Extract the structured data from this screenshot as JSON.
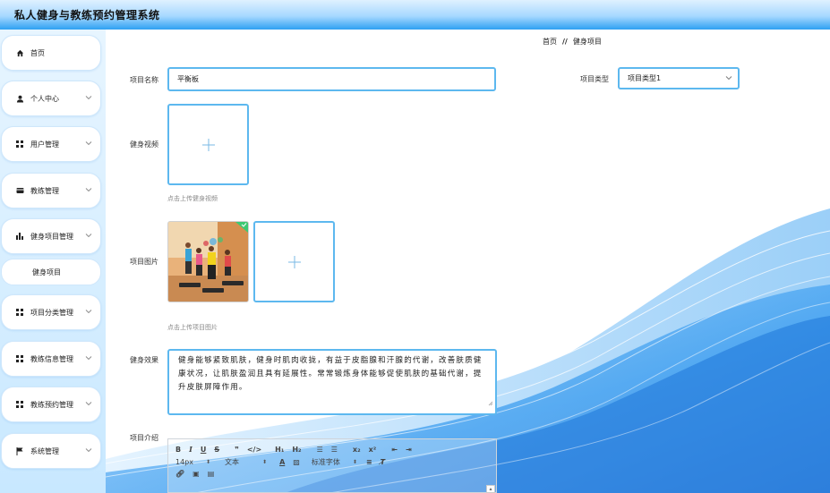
{
  "app": {
    "title": "私人健身与教练预约管理系统"
  },
  "sidebar": {
    "items": [
      {
        "label": "首页",
        "icon": "home-icon",
        "has_arrow": false
      },
      {
        "label": "个人中心",
        "icon": "user-icon",
        "has_arrow": true
      },
      {
        "label": "用户管理",
        "icon": "grid-icon",
        "has_arrow": true
      },
      {
        "label": "教练管理",
        "icon": "card-icon",
        "has_arrow": true
      },
      {
        "label": "健身项目管理",
        "icon": "bar-chart-icon",
        "has_arrow": true,
        "expanded": true
      },
      {
        "label": "项目分类管理",
        "icon": "grid-icon",
        "has_arrow": true
      },
      {
        "label": "教练信息管理",
        "icon": "grid-icon",
        "has_arrow": true
      },
      {
        "label": "教练预约管理",
        "icon": "grid-icon",
        "has_arrow": true
      },
      {
        "label": "系统管理",
        "icon": "flag-icon",
        "has_arrow": true
      }
    ],
    "subitem": {
      "label": "健身项目"
    }
  },
  "breadcrumb": {
    "home": "首页",
    "separator": "//",
    "current": "健身项目"
  },
  "form": {
    "name_label": "项目名称",
    "name_value": "平衡板",
    "type_label": "项目类型",
    "type_value": "项目类型1",
    "video_label": "健身视频",
    "video_hint": "点击上传健身视频",
    "image_label": "项目图片",
    "image_hint": "点击上传项目图片",
    "effect_label": "健身效果",
    "effect_value": "健身能够紧致肌肤，健身时肌肉收拢，有益于皮脂腺和汗腺的代谢，改善肤质健康状况，让肌肤盈润且具有延展性。常常锻炼身体能够促使肌肤的基础代谢，提升皮肤屏障作用。",
    "intro_label": "项目介绍"
  },
  "editor": {
    "font_size": "14px",
    "paragraph": "文本",
    "font_family": "标准字体"
  },
  "colors": {
    "accent": "#5db8ef",
    "topbar": "#2ea0f2",
    "sidebar_bg": "#c8e8ff"
  }
}
